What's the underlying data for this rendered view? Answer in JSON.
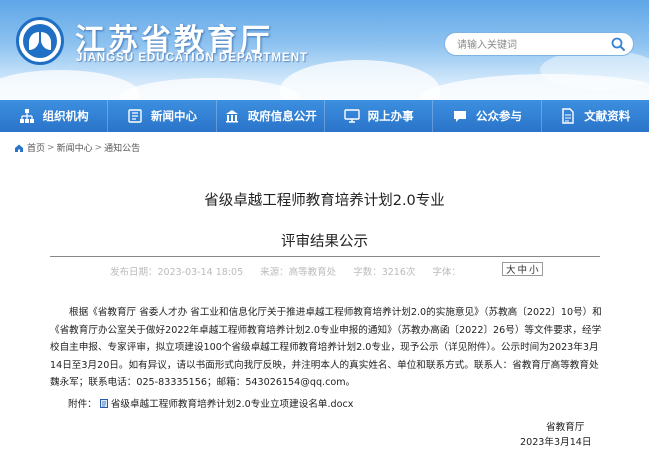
{
  "header": {
    "title_cn": "江苏省教育厅",
    "title_en": "JIANGSU EDUCATION DEPARTMENT",
    "search_placeholder": "请输入关键词"
  },
  "nav": {
    "items": [
      {
        "label": "组织机构",
        "icon": "org-chart-icon"
      },
      {
        "label": "新闻中心",
        "icon": "news-icon"
      },
      {
        "label": "政府信息公开",
        "icon": "government-info-icon"
      },
      {
        "label": "网上办事",
        "icon": "online-service-icon"
      },
      {
        "label": "公众参与",
        "icon": "public-participation-icon"
      },
      {
        "label": "文献资料",
        "icon": "documents-icon"
      }
    ]
  },
  "breadcrumb": {
    "items": [
      "首页",
      "新闻中心",
      "通知公告"
    ],
    "separator": ">"
  },
  "article": {
    "title_line1": "省级卓越工程师教育培养计划2.0专业",
    "title_line2": "评审结果公示",
    "meta": {
      "published": "发布日期：2023-03-14 18:05",
      "source": "来源：高等教育处",
      "word_count": "字数：3216次",
      "font_label": "字体："
    },
    "font_sizes": [
      "大",
      "中",
      "小"
    ],
    "paragraph": "根据《省教育厅 省委人才办 省工业和信息化厅关于推进卓越工程师教育培养计划2.0的实施意见》（苏教高〔2022〕10号）和《省教育厅办公室关于做好2022年卓越工程师教育培养计划2.0专业申报的通知》（苏教办高函〔2022〕26号）等文件要求，经学校自主申报、专家评审，拟立项建设100个省级卓越工程师教育培养计划2.0专业，现予公示（详见附件）。公示时间为2023年3月14日至3月20日。如有异议，请以书面形式向我厅反映，并注明本人的真实姓名、单位和联系方式。联系人：省教育厅高等教育处魏永军；联系电话：025-83335156；邮箱：543026154@qq.com。",
    "attachment_label": "附件：",
    "attachment_name": "省级卓越工程师教育培养计划2.0专业立项建设名单.docx",
    "signature": "省教育厅",
    "date": "2023年3月14日"
  },
  "colors": {
    "nav_bg": "#2a74c9",
    "header_sky": "#5ea6e8",
    "brand_blue": "#1f6fc4"
  }
}
